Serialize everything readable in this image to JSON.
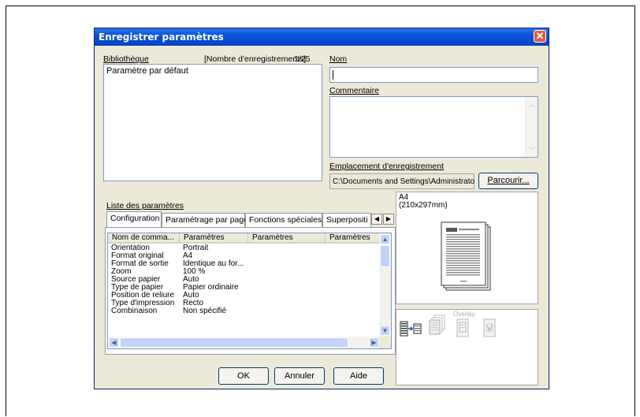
{
  "dialog": {
    "title": "Enregistrer paramètres",
    "close_glyph": "✕"
  },
  "library": {
    "label": "Bibliothèque",
    "count_label": "[Nombre d'enregistrements]",
    "count_value": "1/25",
    "items": [
      "Paramètre par défaut"
    ]
  },
  "name_field": {
    "label": "Nom",
    "value": ""
  },
  "comment_field": {
    "label": "Commentaire",
    "value": ""
  },
  "location": {
    "label": "Emplacement d'enregistrement",
    "path": "C:\\Documents and Settings\\Administrato",
    "browse_label": "Parcourir..."
  },
  "params_list": {
    "label": "Liste des paramètres",
    "tabs": [
      "Configuration",
      "Paramétrage par page",
      "Fonctions spéciales",
      "Superpositi"
    ],
    "columns": [
      "Nom de comma...",
      "Paramètres",
      "Paramètres",
      "Paramètres"
    ],
    "rows": [
      [
        "Orientation",
        "Portrait"
      ],
      [
        "Format original",
        "A4"
      ],
      [
        "Format de sortie",
        "Identique au for..."
      ],
      [
        "Zoom",
        "100 %"
      ],
      [
        "Source papier",
        "Auto"
      ],
      [
        "Type de papier",
        "Papier ordinaire"
      ],
      [
        "Position de reliure",
        "Auto"
      ],
      [
        "Type d'impression",
        "Recto"
      ],
      [
        "Combinaison",
        "Non spécifié"
      ]
    ]
  },
  "preview": {
    "paper_name": "A4",
    "paper_size": "(210x297mm)",
    "overlay_label": "Overlay"
  },
  "buttons": {
    "ok": "OK",
    "cancel": "Annuler",
    "help": "Aide"
  },
  "colors": {
    "title_bar": "#0a53d8",
    "dialog_bg": "#ece9d8",
    "field_border": "#7f9db9"
  }
}
